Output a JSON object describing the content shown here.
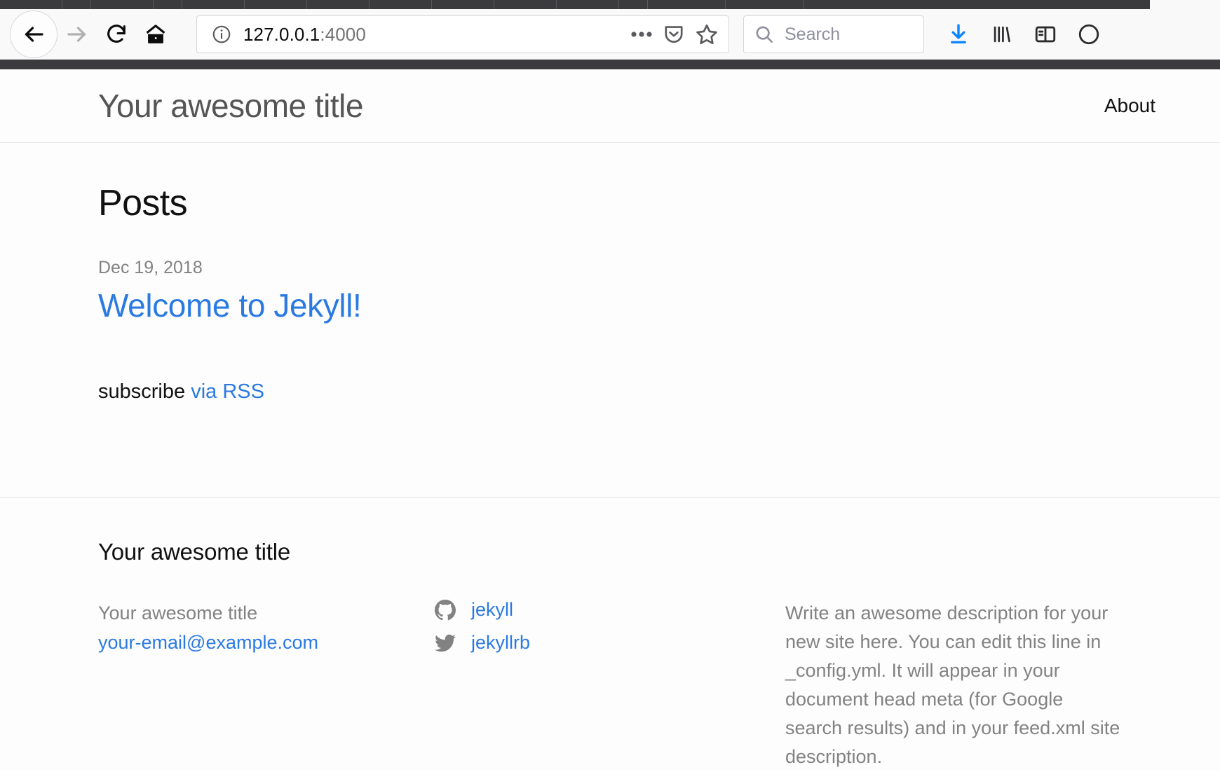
{
  "browser": {
    "back_icon": "back-arrow-icon",
    "forward_icon": "forward-arrow-icon",
    "reload_icon": "reload-icon",
    "home_icon": "home-icon",
    "identity_icon": "info-circle-icon",
    "url": "127.0.0.1",
    "url_port": ":4000",
    "page_actions_icon": "ellipsis-icon",
    "pocket_icon": "pocket-icon",
    "bookmark_icon": "star-icon",
    "search": {
      "icon": "search-icon",
      "placeholder": "Search",
      "value": ""
    },
    "downloads_icon": "download-arrow-icon",
    "library_icon": "library-icon",
    "sidebar_icon": "sidebar-toggle-icon",
    "account_icon": "account-circle-icon",
    "accent_color": "#0a84ff",
    "chrome_background": "#f9f9fa",
    "tabstrip_color": "#3b3b3d"
  },
  "site": {
    "title": "Your awesome title",
    "nav": [
      {
        "label": "About",
        "name": "nav-link-about"
      }
    ],
    "link_color": "#2a7ae2",
    "text_color": "#111111",
    "muted_color": "#828282"
  },
  "main": {
    "heading": "Posts",
    "posts": [
      {
        "date": "Dec 19, 2018",
        "title": "Welcome to Jekyll!"
      }
    ],
    "subscribe_text": "subscribe",
    "subscribe_link_label": "via RSS"
  },
  "footer": {
    "heading": "Your awesome title",
    "contact": {
      "name": "Your awesome title",
      "email": "your-email@example.com"
    },
    "social": [
      {
        "icon": "github-icon",
        "label": "jekyll"
      },
      {
        "icon": "twitter-icon",
        "label": "jekyllrb"
      }
    ],
    "description": "Write an awesome description for your new site here. You can edit this line in _config.yml. It will appear in your document head meta (for Google search results) and in your feed.xml site description."
  }
}
